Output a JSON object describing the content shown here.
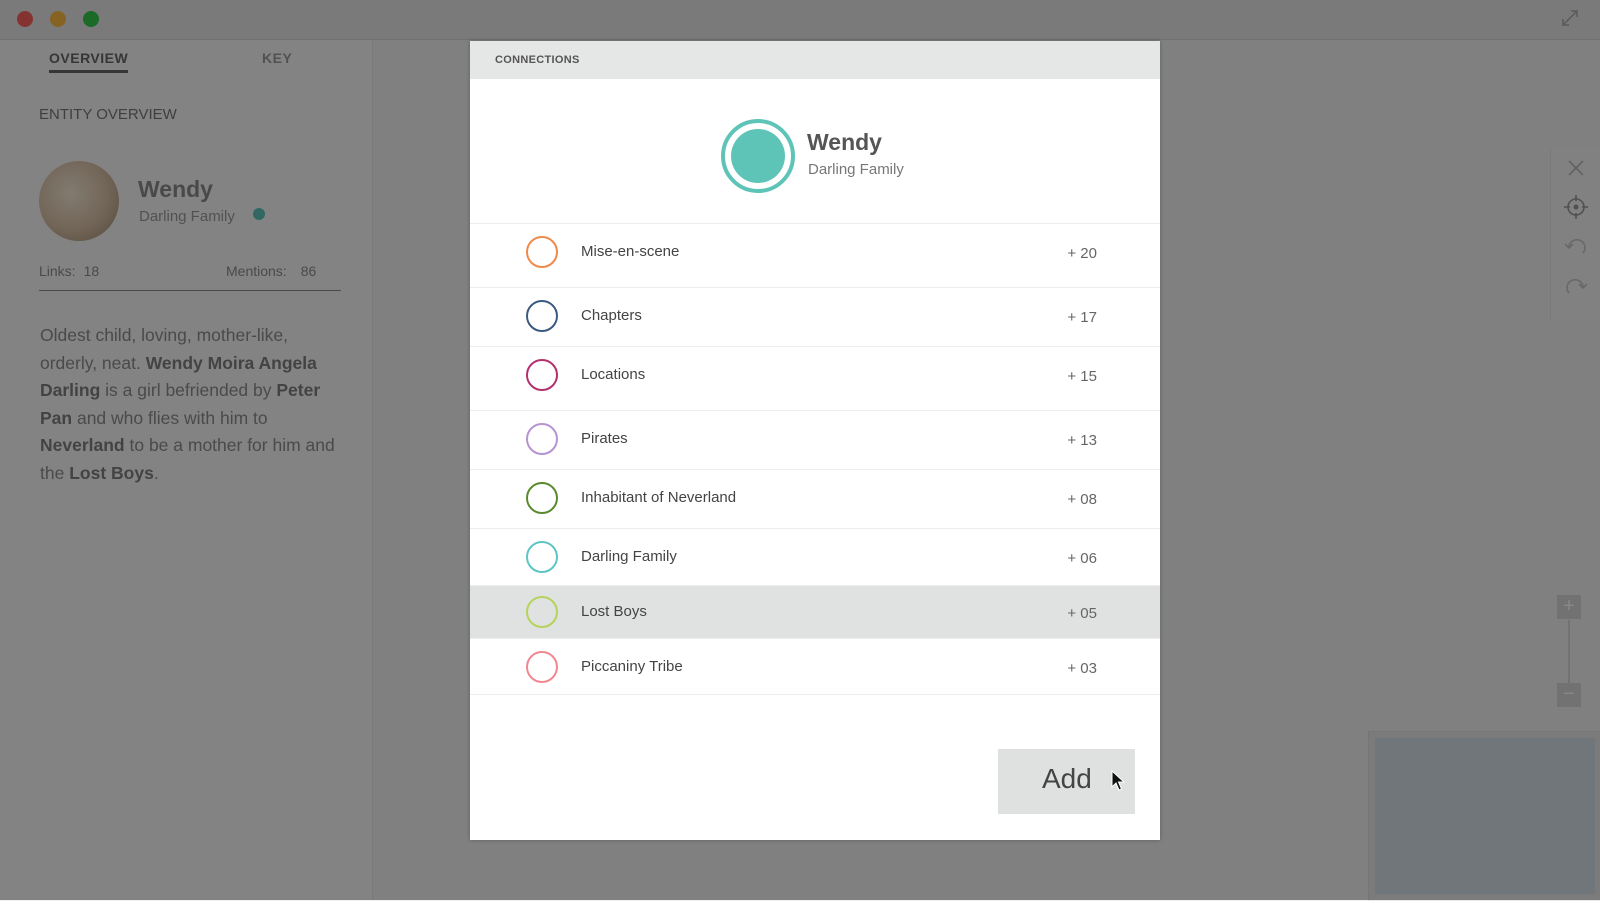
{
  "window": {
    "controls": [
      "close",
      "minimize",
      "maximize"
    ],
    "fullscreen_icon": "fullscreen-icon"
  },
  "sidebar": {
    "tabs": [
      {
        "label": "OVERVIEW",
        "active": true
      },
      {
        "label": "KEY",
        "active": false
      }
    ],
    "section_title": "ENTITY OVERVIEW",
    "entity": {
      "name": "Wendy",
      "group": "Darling Family",
      "group_color": "#5ec4b8"
    },
    "stats": {
      "links_label": "Links:",
      "links_value": "18",
      "mentions_label": "Mentions:",
      "mentions_value": "86"
    },
    "description": {
      "p1": "Oldest child, loving, mother-like, orderly, neat. ",
      "b1": "Wendy Moira Angela Darling",
      "p2": " is a girl befriended by ",
      "b2": "Peter Pan",
      "p3": " and who flies with him to ",
      "b3": "Neverland",
      "p4": " to be a mother for him and the ",
      "b4": "Lost Boys",
      "p5": "."
    }
  },
  "toolbox": {
    "icons": [
      "close-icon",
      "target-icon",
      "undo-icon",
      "redo-icon"
    ],
    "zoom": {
      "plus": "+",
      "minus": "−"
    }
  },
  "dialog": {
    "title": "CONNECTIONS",
    "hero": {
      "name": "Wendy",
      "group": "Darling Family",
      "color": "#5ec4b8"
    },
    "connections": [
      {
        "label": "Mise-en-scene",
        "count": "+ 20",
        "color": "#f08a4b",
        "selected": false
      },
      {
        "label": "Chapters",
        "count": "+ 17",
        "color": "#3a5a80",
        "selected": false
      },
      {
        "label": "Locations",
        "count": "+ 15",
        "color": "#b3306e",
        "selected": false
      },
      {
        "label": "Pirates",
        "count": "+ 13",
        "color": "#b594d1",
        "selected": false
      },
      {
        "label": "Inhabitant of Neverland",
        "count": "+ 08",
        "color": "#5a8a2e",
        "selected": false
      },
      {
        "label": "Darling Family",
        "count": "+ 06",
        "color": "#5ec4c4",
        "selected": false
      },
      {
        "label": "Lost Boys",
        "count": "+ 05",
        "color": "#b5d35a",
        "selected": true
      },
      {
        "label": "Piccaniny Tribe",
        "count": "+ 03",
        "color": "#f08890",
        "selected": false
      }
    ],
    "add_label": "Add"
  }
}
